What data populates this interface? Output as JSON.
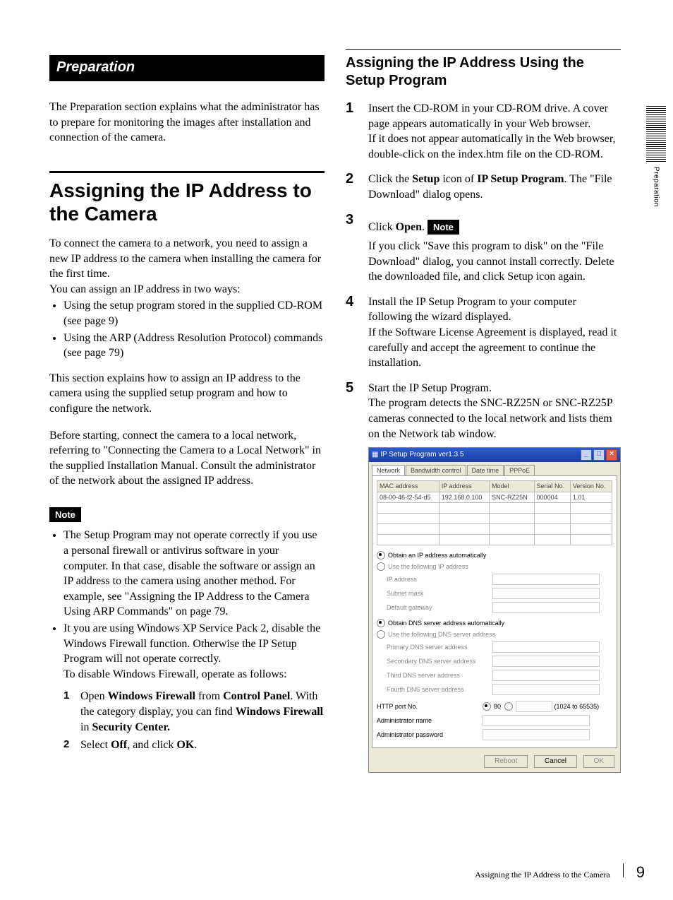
{
  "side": {
    "label": "Preparation"
  },
  "left": {
    "banner": "Preparation",
    "intro": "The Preparation section explains what the administrator has to prepare for monitoring the images after installation and connection of the camera.",
    "h1": "Assigning the IP Address to the Camera",
    "p1": "To connect the camera to a network, you need to assign a new IP address to the camera when installing the camera for the first time.",
    "p2": "You can assign an IP address in two ways:",
    "bul1": "Using the setup program stored in the supplied CD-ROM (see page 9)",
    "bul2": "Using the ARP (Address Resolution Protocol) commands (see page 79)",
    "p3": "This section explains how to assign an IP address to the camera using the supplied setup program and how to configure the network.",
    "p4": "Before starting, connect the camera to a local network, referring to \"Connecting the Camera to a Local Network\" in the supplied Installation Manual. Consult the administrator of the network about the assigned IP address.",
    "note_label": "Note",
    "note_b1": "The Setup Program may not operate correctly if you use a personal firewall or antivirus software in your computer.  In that case, disable the software or assign an IP address to the camera using another method.  For example, see \"Assigning the IP Address to the Camera Using ARP Commands\" on page 79.",
    "note_b2a": "It you are using Windows XP Service Pack 2, disable the Windows Firewall function. Otherwise the IP Setup Program will not operate correctly.",
    "note_b2b": "To disable Windows Firewall, operate as follows:",
    "sub1_pre": "Open ",
    "sub1_b1": "Windows Firewall",
    "sub1_mid1": " from ",
    "sub1_b2": "Control Panel",
    "sub1_post1": ". With the category display, you can find ",
    "sub1_b3": "Windows Firewall",
    "sub1_mid2": " in ",
    "sub1_b4": "Security Center.",
    "sub2_pre": "Select ",
    "sub2_b1": "Off",
    "sub2_mid": ", and click ",
    "sub2_b2": "OK",
    "sub2_post": "."
  },
  "right": {
    "h2": "Assigning the IP Address Using the Setup Program",
    "s1": "Insert the CD-ROM in your CD-ROM drive. A cover page appears automatically in your Web browser.\nIf it does not appear automatically in the Web browser, double-click on the index.htm file on the CD-ROM.",
    "s2_a": "Click the ",
    "s2_b1": "Setup",
    "s2_b": " icon of ",
    "s2_b2": "IP Setup Program",
    "s2_c": ". The \"File Download\" dialog opens.",
    "s3_a": "Click ",
    "s3_b": "Open",
    "s3_c": ".",
    "note_label": "Note",
    "s3_note": "If you click \"Save this program to disk\" on the \"File Download\" dialog, you cannot install correctly. Delete the downloaded file, and click Setup icon again.",
    "s4": "Install the IP Setup Program to your computer following the wizard displayed.\nIf the Software License Agreement is displayed, read it carefully and accept the agreement to continue the installation.",
    "s5": "Start the IP Setup Program.\nThe program detects the SNC-RZ25N or SNC-RZ25P cameras connected to the local network and lists them on the Network tab window."
  },
  "shot": {
    "title": "IP Setup Program ver1.3.5",
    "tabs": [
      "Network",
      "Bandwidth control",
      "Date time",
      "PPPoE"
    ],
    "cols": [
      "MAC address",
      "IP address",
      "Model",
      "Serial No.",
      "Version No."
    ],
    "row": [
      "08-00-46-f2-54-d5",
      "192.168.0.100",
      "SNC-RZ25N",
      "000004",
      "1.01"
    ],
    "opt_ip_auto": "Obtain an IP address automatically",
    "opt_ip_man": "Use the following IP address",
    "f_ip": "IP address",
    "f_mask": "Subnet mask",
    "f_gw": "Default gateway",
    "opt_dns_auto": "Obtain DNS server address automatically",
    "opt_dns_man": "Use the following DNS server address",
    "f_dns1": "Primary DNS server address",
    "f_dns2": "Secondary DNS server address",
    "f_dns3": "Third DNS server address",
    "f_dns4": "Fourth DNS server address",
    "f_port": "HTTP port No.",
    "port_def": "80",
    "port_range": "(1024 to 65535)",
    "f_admin": "Administrator name",
    "f_pass": "Administrator password",
    "btn_reboot": "Reboot",
    "btn_cancel": "Cancel",
    "btn_ok": "OK"
  },
  "footer": {
    "title": "Assigning the IP Address to the Camera",
    "page": "9"
  }
}
